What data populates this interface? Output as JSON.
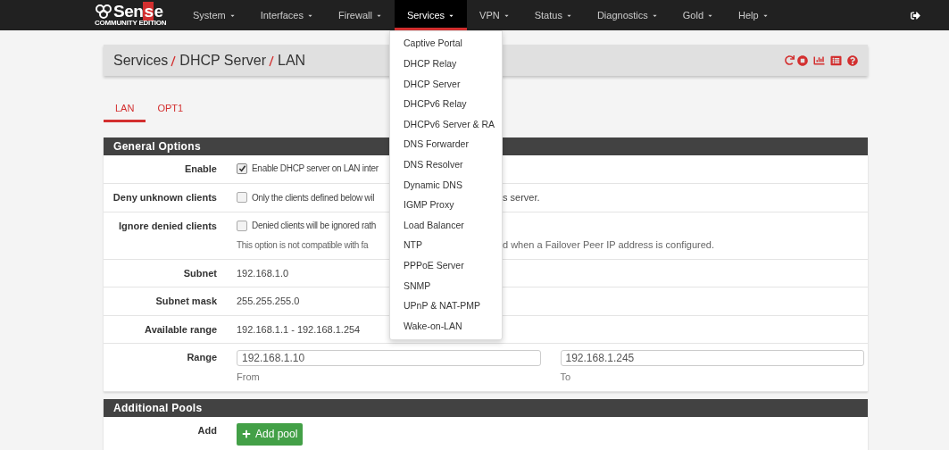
{
  "navbar": {
    "logo": {
      "text": "Sense",
      "subtitle": "COMMUNITY EDITION"
    },
    "menus": [
      {
        "label": "System",
        "selected": false
      },
      {
        "label": "Interfaces",
        "selected": false
      },
      {
        "label": "Firewall",
        "selected": false
      },
      {
        "label": "Services",
        "selected": true
      },
      {
        "label": "VPN",
        "selected": false
      },
      {
        "label": "Status",
        "selected": false
      },
      {
        "label": "Diagnostics",
        "selected": false
      },
      {
        "label": "Gold",
        "selected": false
      },
      {
        "label": "Help",
        "selected": false
      }
    ]
  },
  "dropdown": {
    "items": [
      "Captive Portal",
      "DHCP Relay",
      "DHCP Server",
      "DHCPv6 Relay",
      "DHCPv6 Server & RA",
      "DNS Forwarder",
      "DNS Resolver",
      "Dynamic DNS",
      "IGMP Proxy",
      "Load Balancer",
      "NTP",
      "PPPoE Server",
      "SNMP",
      "UPnP & NAT-PMP",
      "Wake-on-LAN"
    ]
  },
  "breadcrumb": [
    "Services",
    "DHCP Server",
    "LAN"
  ],
  "tabs": [
    {
      "label": "LAN",
      "selected": true
    },
    {
      "label": "OPT1",
      "selected": false
    }
  ],
  "sections": [
    {
      "title": "General Options",
      "rows": [
        {
          "kind": "checkbox",
          "label": "Enable",
          "checked": true,
          "text": "Enable DHCP server on LAN inter"
        },
        {
          "kind": "checkbox",
          "label": "Deny unknown clients",
          "checked": false,
          "text": "Only the clients defined below wil",
          "text_after": "s server."
        },
        {
          "kind": "checkbox",
          "label": "Ignore denied clients",
          "checked": false,
          "text": "Denied clients will be ignored rath",
          "note": "This option is not compatible with fa",
          "note_after": "d when a Failover Peer IP address is configured."
        },
        {
          "kind": "text",
          "label": "Subnet",
          "value": "192.168.1.0"
        },
        {
          "kind": "text",
          "label": "Subnet mask",
          "value": "255.255.255.0"
        },
        {
          "kind": "text",
          "label": "Available range",
          "value": "192.168.1.1 - 192.168.1.254"
        },
        {
          "kind": "range",
          "label": "Range",
          "from": {
            "value": "192.168.1.10",
            "caption": "From"
          },
          "to": {
            "value": "192.168.1.245",
            "caption": "To"
          }
        }
      ]
    },
    {
      "title": "Additional Pools",
      "rows": [
        {
          "kind": "button",
          "label": "Add",
          "button": "Add pool"
        }
      ]
    }
  ]
}
